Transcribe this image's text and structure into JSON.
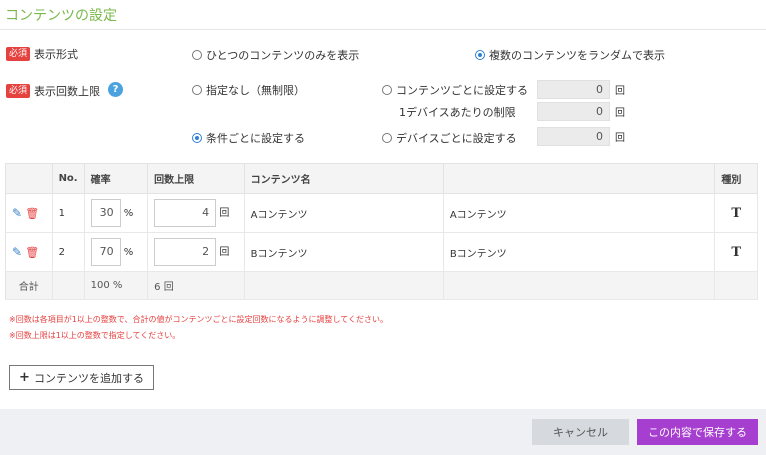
{
  "header": {
    "title": "コンテンツの設定"
  },
  "required_badge": "必須",
  "display_format": {
    "label": "表示形式",
    "options": [
      "ひとつのコンテンツのみを表示",
      "複数のコンテンツをランダムで表示"
    ],
    "selected": 1
  },
  "display_limit": {
    "label": "表示回数上限",
    "help": "?",
    "opt_none": "指定なし（無制限）",
    "opt_conditional": "条件ごとに設定する",
    "opt_per_content": "コンテンツごとに設定する",
    "per_device_label": "1デバイスあたりの制限",
    "opt_per_device": "デバイスごとに設定する",
    "per_content_value": "0",
    "per_device_limit_value": "0",
    "device_value": "0",
    "unit": "回",
    "selected": "conditional"
  },
  "table": {
    "headers": {
      "no": "No.",
      "rate": "確率",
      "limit": "回数上限",
      "name": "コンテンツ名",
      "extra": "",
      "type": "種別"
    },
    "rows": [
      {
        "no": "1",
        "rate": "30",
        "rate_unit": "%",
        "limit": "4",
        "limit_unit": "回",
        "name": "Aコンテンツ",
        "name2": "Aコンテンツ",
        "type": "T"
      },
      {
        "no": "2",
        "rate": "70",
        "rate_unit": "%",
        "limit": "2",
        "limit_unit": "回",
        "name": "Bコンテンツ",
        "name2": "Bコンテンツ",
        "type": "T"
      }
    ],
    "total": {
      "label": "合計",
      "rate": "100 %",
      "limit": "6 回"
    }
  },
  "notes": [
    "※回数は各項目が1以上の整数で、合計の値がコンテンツごとに設定回数になるように調整してください。",
    "※回数上限は1以上の整数で指定してください。"
  ],
  "add_button": {
    "icon": "+",
    "label": "コンテンツを追加する"
  },
  "footer": {
    "cancel": "キャンセル",
    "save": "この内容で保存する"
  },
  "colors": {
    "accent": "#7ab84a",
    "required": "#e5413f",
    "save": "#a63fcf",
    "radio": "#2f7fd8"
  }
}
